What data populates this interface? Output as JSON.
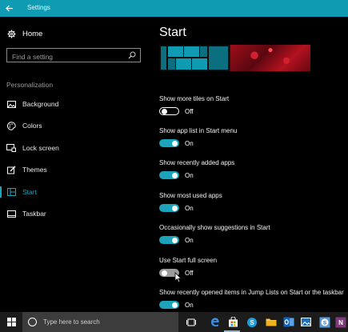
{
  "window": {
    "title": "Settings",
    "back_icon": "back-arrow-icon",
    "accent": "#0f9bb1"
  },
  "sidebar": {
    "home_label": "Home",
    "home_icon": "gear-icon",
    "search_placeholder": "Find a setting",
    "section_label": "Personalization",
    "items": [
      {
        "label": "Background",
        "icon": "picture-icon"
      },
      {
        "label": "Colors",
        "icon": "palette-icon"
      },
      {
        "label": "Lock screen",
        "icon": "monitor-lock-icon"
      },
      {
        "label": "Themes",
        "icon": "brush-icon"
      },
      {
        "label": "Start",
        "icon": "start-grid-icon",
        "active": true
      },
      {
        "label": "Taskbar",
        "icon": "taskbar-icon"
      }
    ]
  },
  "main": {
    "page_title": "Start",
    "settings": [
      {
        "label": "Show more tiles on Start",
        "state": "Off",
        "on": false
      },
      {
        "label": "Show app list in Start menu",
        "state": "On",
        "on": true
      },
      {
        "label": "Show recently added apps",
        "state": "On",
        "on": true
      },
      {
        "label": "Show most used apps",
        "state": "On",
        "on": true
      },
      {
        "label": "Occasionally show suggestions in Start",
        "state": "On",
        "on": true
      },
      {
        "label": "Use Start full screen",
        "state": "Off",
        "on": false
      },
      {
        "label": "Show recently opened items in Jump Lists on Start or the taskbar",
        "state": "On",
        "on": true
      }
    ]
  },
  "taskbar": {
    "search_placeholder": "Type here to search",
    "icons": [
      "windows-logo-icon",
      "task-view-icon",
      "edge-icon",
      "store-icon",
      "skype-icon",
      "file-explorer-icon",
      "outlook-icon",
      "photos-icon",
      "skype-business-icon",
      "onenote-icon"
    ]
  }
}
